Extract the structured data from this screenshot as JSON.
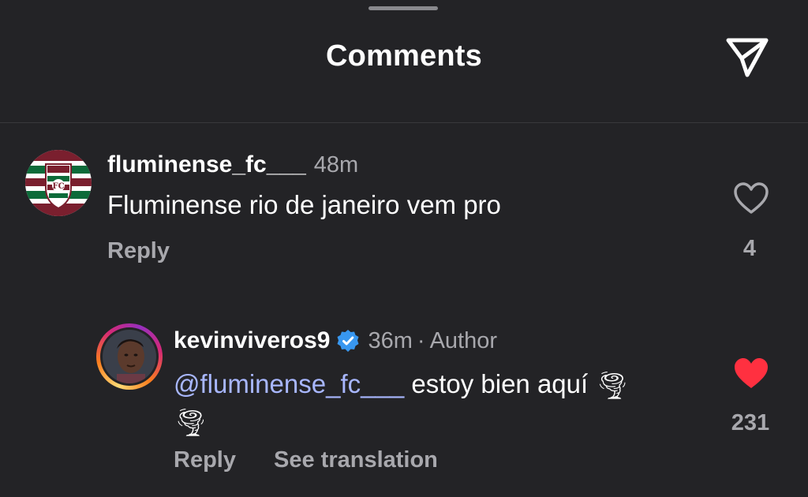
{
  "header": {
    "title": "Comments",
    "share_icon": "paper-plane-icon"
  },
  "comments": [
    {
      "username": "fluminense_fc___",
      "time": "48m",
      "text": "Fluminense rio de janeiro vem pro",
      "reply_label": "Reply",
      "likes": "4",
      "liked": false,
      "avatar_icon": "fluminense-crest-icon"
    },
    {
      "username": "kevinviveros9",
      "verified": true,
      "time": "36m",
      "separator": "·",
      "author_label": "Author",
      "mention": "@fluminense_fc___",
      "text": "estoy bien aquí",
      "emoji": "🌪",
      "reply_label": "Reply",
      "translate_label": "See translation",
      "likes": "231",
      "liked": true,
      "avatar_icon": "profile-photo"
    }
  ],
  "colors": {
    "background": "#232326",
    "heart_active": "#ff3040",
    "mention": "#a8b7ff",
    "verified": "#3897f0",
    "muted_text": "#a8a8ad"
  }
}
